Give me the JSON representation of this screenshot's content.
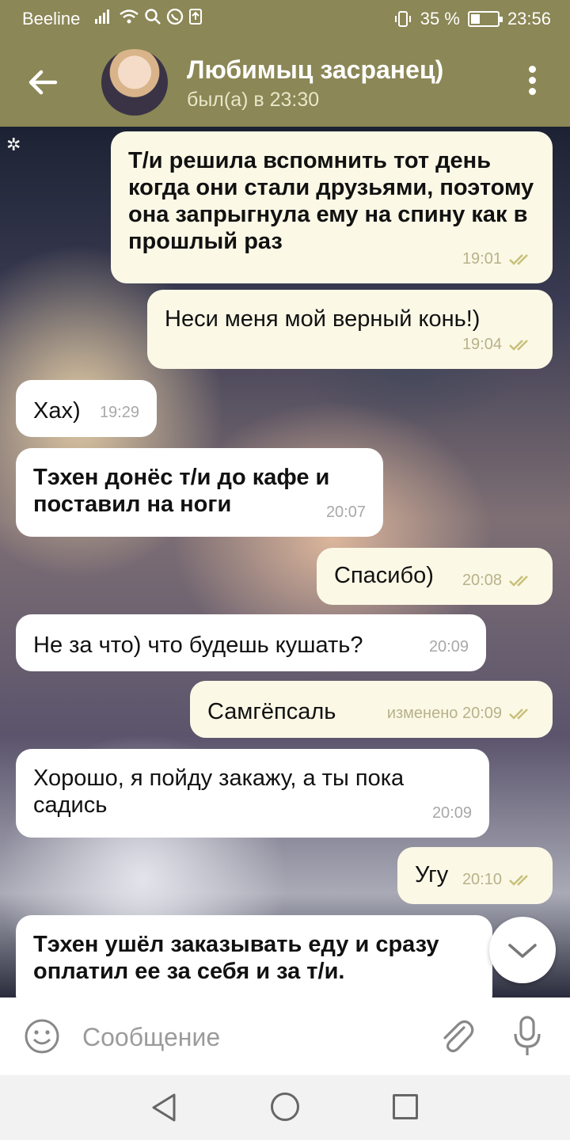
{
  "status_bar": {
    "carrier": "Beeline",
    "battery": "35 %",
    "time": "23:56",
    "icons": [
      "signal-icon",
      "wifi-icon",
      "search-icon",
      "whatsapp-icon",
      "upload-icon",
      "vibrate-icon",
      "battery-icon"
    ]
  },
  "header": {
    "title": "Любимыц засранец)",
    "subtitle": "был(а) в 23:30"
  },
  "messages": [
    {
      "direction": "out",
      "bold": true,
      "text": "Т/и решила вспомнить тот день когда они стали друзьями, поэтому она запрыгнула ему на спину как в прошлый раз",
      "time": "19:01",
      "read": true
    },
    {
      "direction": "out",
      "bold": false,
      "text": "Неси меня мой верный конь!)",
      "time": "19:04",
      "read": true
    },
    {
      "direction": "in",
      "bold": false,
      "text": "Хах)",
      "time": "19:29"
    },
    {
      "direction": "in",
      "bold": true,
      "text": "Тэхен донёс т/и до кафе и поставил на ноги",
      "time": "20:07"
    },
    {
      "direction": "out",
      "bold": false,
      "text": "Спасибо)",
      "time": "20:08",
      "read": true
    },
    {
      "direction": "in",
      "bold": false,
      "text": "Не за что) что будешь кушать?",
      "time": "20:09"
    },
    {
      "direction": "out",
      "bold": false,
      "text": "Самгёпсаль",
      "time": "изменено 20:09",
      "read": true
    },
    {
      "direction": "in",
      "bold": false,
      "text": "Хорошо, я пойду закажу, а ты пока садись",
      "time": "20:09"
    },
    {
      "direction": "out",
      "bold": false,
      "text": "Угу",
      "time": "20:10",
      "read": true
    },
    {
      "direction": "in",
      "bold": true,
      "text": "Тэхен ушёл заказывать еду и сразу оплатил ее за себя и за т/и.",
      "time": ""
    }
  ],
  "input": {
    "placeholder": "Сообщение"
  },
  "colors": {
    "header_bg": "#8b8756",
    "outgoing_bubble": "#fbf8e6",
    "incoming_bubble": "#ffffff",
    "read_ticks": "#c8c07a"
  }
}
